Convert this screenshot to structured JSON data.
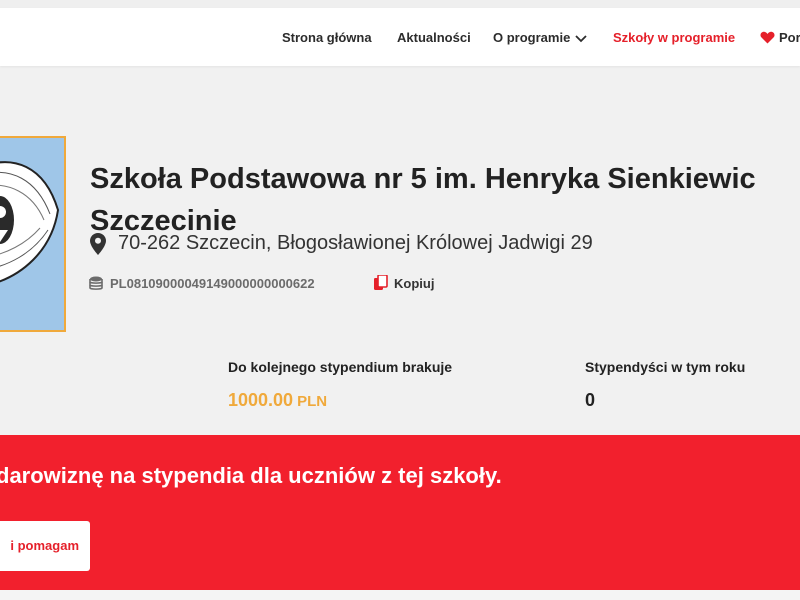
{
  "nav": {
    "items": [
      {
        "label": "Strona główna"
      },
      {
        "label": "Aktualności"
      },
      {
        "label": "O programie"
      },
      {
        "label": "Szkoły w programie"
      },
      {
        "label": "Por"
      }
    ],
    "active_color": "#e5202a",
    "icons": [
      "chevron-down-icon",
      "heart-icon"
    ]
  },
  "school": {
    "name_line1": "Szkoła Podstawowa nr 5 im. Henryka Sienkiewic",
    "name_line2": "Szczecinie",
    "address": "70-262 Szczecin, Błogosławionej Królowej Jadwigi 29",
    "account_number": "PL08109000049149000000000622",
    "copy_label": "Kopiuj",
    "icons": [
      "map-pin-icon",
      "coins-icon",
      "copy-icon"
    ]
  },
  "stats": {
    "missing_label": "Do kolejnego stypendium brakuje",
    "missing_amount": "1000.00",
    "missing_currency": "PLN",
    "scholars_label": "Stypendyści w tym roku",
    "scholars_count": "0"
  },
  "banner": {
    "text": "darowiznę na stypendia dla uczniów z tej szkoły.",
    "button_label": "i pomagam",
    "background": "#f2202d"
  },
  "colors": {
    "accent_orange": "#f0a93b",
    "accent_red": "#e5202a"
  }
}
